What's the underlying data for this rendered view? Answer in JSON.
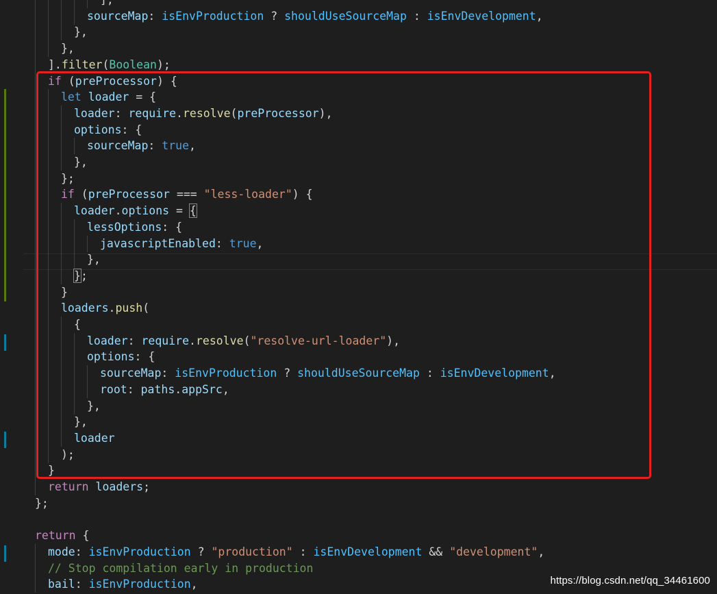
{
  "editor": {
    "theme_colors": {
      "background": "#1e1e1e",
      "keyword": "#c586c0",
      "declaration": "#569cd6",
      "variable": "#9cdcfe",
      "constant": "#4fc1ff",
      "function": "#dcdcaa",
      "type": "#4ec9b0",
      "string": "#ce9178",
      "comment": "#6a9955",
      "highlight_box": "#e5211f",
      "gutter_modified": "#587c0c",
      "gutter_changed": "#0c7d9d"
    },
    "lines": [
      {
        "indent": 5,
        "tokens": [
          {
            "t": "],",
            "c": "punct"
          }
        ]
      },
      {
        "indent": 4,
        "tokens": [
          {
            "t": "sourceMap",
            "c": "var"
          },
          {
            "t": ": ",
            "c": "punct"
          },
          {
            "t": "isEnvProduction",
            "c": "const"
          },
          {
            "t": " ? ",
            "c": "punct"
          },
          {
            "t": "shouldUseSourceMap",
            "c": "const"
          },
          {
            "t": " : ",
            "c": "punct"
          },
          {
            "t": "isEnvDevelopment",
            "c": "const"
          },
          {
            "t": ",",
            "c": "punct"
          }
        ]
      },
      {
        "indent": 3,
        "tokens": [
          {
            "t": "},",
            "c": "punct"
          }
        ]
      },
      {
        "indent": 2,
        "tokens": [
          {
            "t": "},",
            "c": "punct"
          }
        ]
      },
      {
        "indent": 1,
        "tokens": [
          {
            "t": "].",
            "c": "punct"
          },
          {
            "t": "filter",
            "c": "fn"
          },
          {
            "t": "(",
            "c": "punct"
          },
          {
            "t": "Boolean",
            "c": "type"
          },
          {
            "t": ");",
            "c": "punct"
          }
        ]
      },
      {
        "indent": 1,
        "tokens": [
          {
            "t": "if",
            "c": "kw"
          },
          {
            "t": " (",
            "c": "punct"
          },
          {
            "t": "preProcessor",
            "c": "var"
          },
          {
            "t": ") {",
            "c": "punct"
          }
        ]
      },
      {
        "indent": 2,
        "tokens": [
          {
            "t": "let",
            "c": "decl"
          },
          {
            "t": " ",
            "c": "punct"
          },
          {
            "t": "loader",
            "c": "var"
          },
          {
            "t": " = {",
            "c": "punct"
          }
        ]
      },
      {
        "indent": 3,
        "tokens": [
          {
            "t": "loader",
            "c": "var"
          },
          {
            "t": ": ",
            "c": "punct"
          },
          {
            "t": "require",
            "c": "var"
          },
          {
            "t": ".",
            "c": "punct"
          },
          {
            "t": "resolve",
            "c": "fn"
          },
          {
            "t": "(",
            "c": "punct"
          },
          {
            "t": "preProcessor",
            "c": "var"
          },
          {
            "t": "),",
            "c": "punct"
          }
        ]
      },
      {
        "indent": 3,
        "tokens": [
          {
            "t": "options",
            "c": "var"
          },
          {
            "t": ": {",
            "c": "punct"
          }
        ]
      },
      {
        "indent": 4,
        "tokens": [
          {
            "t": "sourceMap",
            "c": "var"
          },
          {
            "t": ": ",
            "c": "punct"
          },
          {
            "t": "true",
            "c": "lit"
          },
          {
            "t": ",",
            "c": "punct"
          }
        ]
      },
      {
        "indent": 3,
        "tokens": [
          {
            "t": "},",
            "c": "punct"
          }
        ]
      },
      {
        "indent": 2,
        "tokens": [
          {
            "t": "};",
            "c": "punct"
          }
        ]
      },
      {
        "indent": 2,
        "tokens": [
          {
            "t": "if",
            "c": "kw"
          },
          {
            "t": " (",
            "c": "punct"
          },
          {
            "t": "preProcessor",
            "c": "var"
          },
          {
            "t": " === ",
            "c": "punct"
          },
          {
            "t": "\"less-loader\"",
            "c": "str"
          },
          {
            "t": ") {",
            "c": "punct"
          }
        ]
      },
      {
        "indent": 3,
        "tokens": [
          {
            "t": "loader",
            "c": "var"
          },
          {
            "t": ".",
            "c": "punct"
          },
          {
            "t": "options",
            "c": "var"
          },
          {
            "t": " = ",
            "c": "punct"
          },
          {
            "t": "{",
            "c": "punct",
            "match": true
          }
        ]
      },
      {
        "indent": 4,
        "tokens": [
          {
            "t": "lessOptions",
            "c": "var"
          },
          {
            "t": ": {",
            "c": "punct"
          }
        ]
      },
      {
        "indent": 5,
        "tokens": [
          {
            "t": "javascriptEnabled",
            "c": "var"
          },
          {
            "t": ": ",
            "c": "punct"
          },
          {
            "t": "true",
            "c": "lit"
          },
          {
            "t": ",",
            "c": "punct"
          }
        ]
      },
      {
        "indent": 4,
        "tokens": [
          {
            "t": "},",
            "c": "punct"
          }
        ]
      },
      {
        "indent": 3,
        "tokens": [
          {
            "t": "}",
            "c": "punct",
            "match": true
          },
          {
            "t": ";",
            "c": "punct"
          }
        ]
      },
      {
        "indent": 2,
        "tokens": [
          {
            "t": "}",
            "c": "punct"
          }
        ]
      },
      {
        "indent": 2,
        "tokens": [
          {
            "t": "loaders",
            "c": "var"
          },
          {
            "t": ".",
            "c": "punct"
          },
          {
            "t": "push",
            "c": "fn"
          },
          {
            "t": "(",
            "c": "punct"
          }
        ]
      },
      {
        "indent": 3,
        "tokens": [
          {
            "t": "{",
            "c": "punct"
          }
        ]
      },
      {
        "indent": 4,
        "tokens": [
          {
            "t": "loader",
            "c": "var"
          },
          {
            "t": ": ",
            "c": "punct"
          },
          {
            "t": "require",
            "c": "var"
          },
          {
            "t": ".",
            "c": "punct"
          },
          {
            "t": "resolve",
            "c": "fn"
          },
          {
            "t": "(",
            "c": "punct"
          },
          {
            "t": "\"resolve-url-loader\"",
            "c": "str"
          },
          {
            "t": "),",
            "c": "punct"
          }
        ]
      },
      {
        "indent": 4,
        "tokens": [
          {
            "t": "options",
            "c": "var"
          },
          {
            "t": ": {",
            "c": "punct"
          }
        ]
      },
      {
        "indent": 5,
        "tokens": [
          {
            "t": "sourceMap",
            "c": "var"
          },
          {
            "t": ": ",
            "c": "punct"
          },
          {
            "t": "isEnvProduction",
            "c": "const"
          },
          {
            "t": " ? ",
            "c": "punct"
          },
          {
            "t": "shouldUseSourceMap",
            "c": "const"
          },
          {
            "t": " : ",
            "c": "punct"
          },
          {
            "t": "isEnvDevelopment",
            "c": "const"
          },
          {
            "t": ",",
            "c": "punct"
          }
        ]
      },
      {
        "indent": 5,
        "tokens": [
          {
            "t": "root",
            "c": "var"
          },
          {
            "t": ": ",
            "c": "punct"
          },
          {
            "t": "paths",
            "c": "var"
          },
          {
            "t": ".",
            "c": "punct"
          },
          {
            "t": "appSrc",
            "c": "var"
          },
          {
            "t": ",",
            "c": "punct"
          }
        ]
      },
      {
        "indent": 4,
        "tokens": [
          {
            "t": "},",
            "c": "punct"
          }
        ]
      },
      {
        "indent": 3,
        "tokens": [
          {
            "t": "},",
            "c": "punct"
          }
        ]
      },
      {
        "indent": 3,
        "tokens": [
          {
            "t": "loader",
            "c": "var"
          }
        ]
      },
      {
        "indent": 2,
        "tokens": [
          {
            "t": ");",
            "c": "punct"
          }
        ]
      },
      {
        "indent": 1,
        "tokens": [
          {
            "t": "}",
            "c": "punct"
          }
        ]
      },
      {
        "indent": 1,
        "tokens": [
          {
            "t": "return",
            "c": "kw"
          },
          {
            "t": " ",
            "c": "punct"
          },
          {
            "t": "loaders",
            "c": "var"
          },
          {
            "t": ";",
            "c": "punct"
          }
        ]
      },
      {
        "indent": 0,
        "tokens": [
          {
            "t": "};",
            "c": "punct"
          }
        ]
      },
      {
        "indent": 0,
        "tokens": []
      },
      {
        "indent": 0,
        "tokens": [
          {
            "t": "return",
            "c": "kw"
          },
          {
            "t": " {",
            "c": "punct"
          }
        ]
      },
      {
        "indent": 1,
        "tokens": [
          {
            "t": "mode",
            "c": "var"
          },
          {
            "t": ": ",
            "c": "punct"
          },
          {
            "t": "isEnvProduction",
            "c": "const"
          },
          {
            "t": " ? ",
            "c": "punct"
          },
          {
            "t": "\"production\"",
            "c": "str"
          },
          {
            "t": " : ",
            "c": "punct"
          },
          {
            "t": "isEnvDevelopment",
            "c": "const"
          },
          {
            "t": " && ",
            "c": "punct"
          },
          {
            "t": "\"development\"",
            "c": "str"
          },
          {
            "t": ",",
            "c": "punct"
          }
        ]
      },
      {
        "indent": 1,
        "tokens": [
          {
            "t": "// Stop compilation early in production",
            "c": "comment"
          }
        ]
      },
      {
        "indent": 1,
        "tokens": [
          {
            "t": "bail",
            "c": "var"
          },
          {
            "t": ": ",
            "c": "punct"
          },
          {
            "t": "isEnvProduction",
            "c": "const"
          },
          {
            "t": ",",
            "c": "punct"
          }
        ]
      }
    ]
  },
  "watermark": "https://blog.csdn.net/qq_34461600"
}
